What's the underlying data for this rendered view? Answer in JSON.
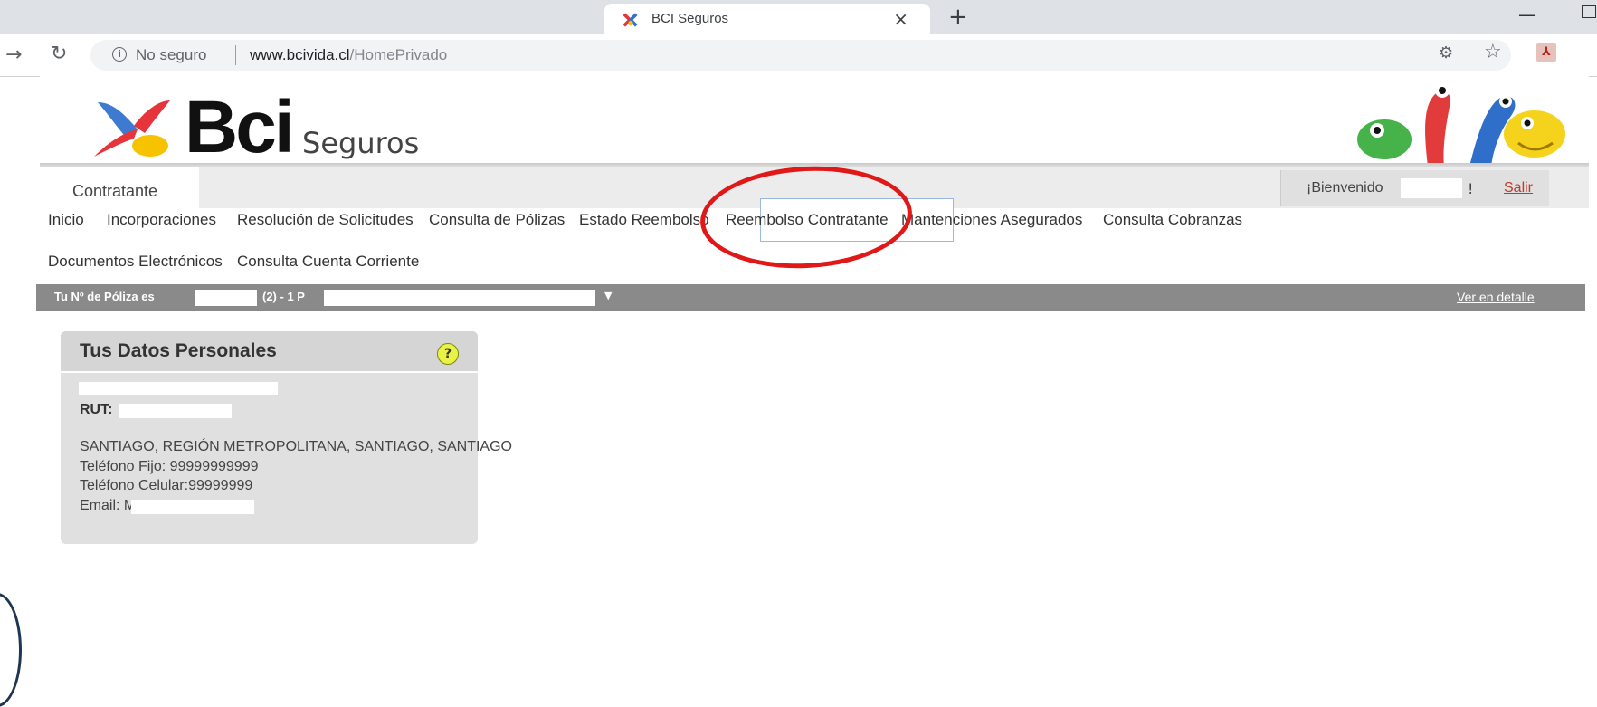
{
  "browser": {
    "tab_title": "BCI Seguros",
    "tab_close": "×",
    "new_tab": "+",
    "security": "No seguro",
    "url_host": "www.bcivida.cl",
    "url_path": "/HomePrivado"
  },
  "header": {
    "logo_text": "Bci",
    "logo_subtext": "Seguros"
  },
  "tabs": {
    "active": "Contratante"
  },
  "user": {
    "welcome": "¡Bienvenido",
    "excl": "!",
    "logout": "Salir"
  },
  "menu": {
    "row1": [
      "Inicio",
      "Incorporaciones",
      "Resolución de Solicitudes",
      "Consulta de Pólizas",
      "Estado Reembolso",
      "Reembolso Contratante",
      "Mantenciones Asegurados",
      "Consulta Cobranzas"
    ],
    "row2": [
      "Documentos Electrónicos",
      "Consulta Cuenta Corriente"
    ]
  },
  "policy": {
    "label": "Tu Nº de Póliza es",
    "middle": "(2) - 1 P",
    "detail_link": "Ver en detalle"
  },
  "card": {
    "title": "Tus Datos Personales",
    "help": "?",
    "rut_label": "RUT:",
    "address": "SANTIAGO, REGIÓN METROPOLITANA, SANTIAGO, SANTIAGO",
    "phone": "Teléfono Fijo: 99999999999",
    "mobile": "Teléfono Celular:99999999",
    "email": "Email: M"
  },
  "colors": {
    "annotation": "#e01818",
    "highlight_border": "#9ab8e0",
    "policy_bar": "#8a8a8a",
    "logout_link": "#c0392b"
  }
}
